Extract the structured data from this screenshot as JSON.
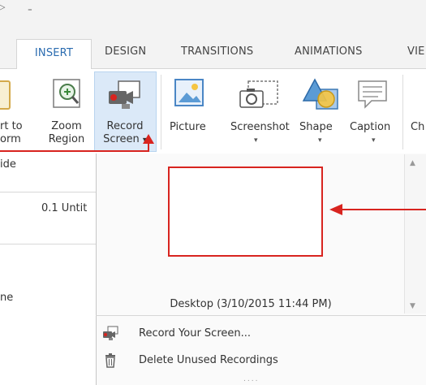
{
  "quick_access": {
    "arrow_glyph": "▷",
    "dropdown_glyph": "₌"
  },
  "tabs": [
    "INSERT",
    "DESIGN",
    "TRANSITIONS",
    "ANIMATIONS",
    "VIE"
  ],
  "ribbon": {
    "slide_fragment": {
      "line1": "rt to",
      "line2": "orm"
    },
    "zoom": {
      "line1": "Zoom",
      "line2": "Region"
    },
    "record": {
      "line1": "Record",
      "line2": "Screen",
      "caret": "▾"
    },
    "picture": "Picture",
    "screenshot": "Screenshot",
    "shape": "Shape",
    "caption": "Caption",
    "chart_fragment": "Ch",
    "caret": "▾"
  },
  "left_panel": {
    "group_fragment": "ide",
    "item1": "0.1 Untit",
    "item2": "ne"
  },
  "gallery": {
    "thumbnail_caption": "Desktop (3/10/2015 11:44 PM)",
    "scroll_up": "▲",
    "scroll_down": "▼"
  },
  "menu": {
    "record_your_screen": "Record Your Screen...",
    "delete_unused": "Delete Unused Recordings",
    "grip": "...."
  },
  "colors": {
    "accent": "#2b6cb0",
    "annotation_red": "#d8241f",
    "hover_blue": "#dbe9f8"
  }
}
